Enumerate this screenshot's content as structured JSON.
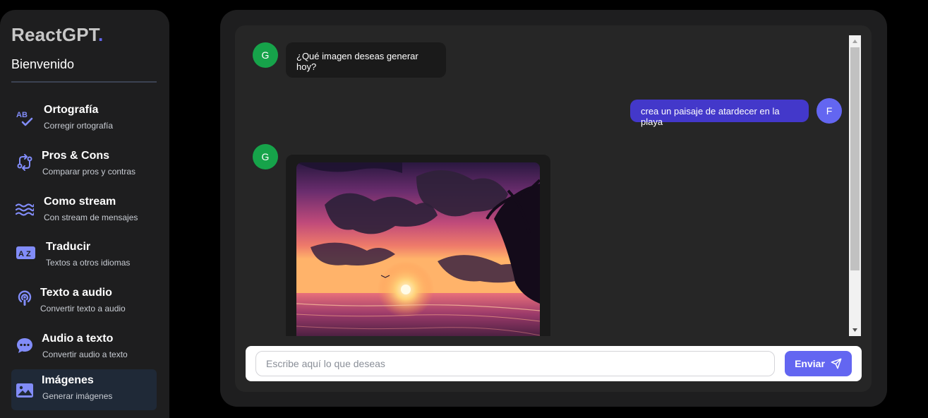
{
  "sidebar": {
    "brand": "ReactGPT",
    "brand_dot": ".",
    "welcome": "Bienvenido",
    "items": [
      {
        "title": "Ortografía",
        "subtitle": "Corregir ortografía",
        "icon": "spellcheck-icon"
      },
      {
        "title": "Pros & Cons",
        "subtitle": "Comparar pros y contras",
        "icon": "compare-arrows-icon"
      },
      {
        "title": "Como stream",
        "subtitle": "Con stream de mensajes",
        "icon": "waves-icon"
      },
      {
        "title": "Traducir",
        "subtitle": "Textos a otros idiomas",
        "icon": "translate-icon"
      },
      {
        "title": "Texto a audio",
        "subtitle": "Convertir texto a audio",
        "icon": "podcast-icon"
      },
      {
        "title": "Audio a texto",
        "subtitle": "Convertir audio a texto",
        "icon": "chat-bubble-icon"
      },
      {
        "title": "Imágenes",
        "subtitle": "Generar imágenes",
        "icon": "image-icon",
        "active": true
      }
    ]
  },
  "chat": {
    "messages": [
      {
        "from": "bot",
        "avatar": "G",
        "text": "¿Qué imagen deseas generar hoy?"
      },
      {
        "from": "user",
        "avatar": "F",
        "text": "crea un paisaje de atardecer en la playa"
      },
      {
        "from": "bot",
        "avatar": "G",
        "type": "image",
        "image": "sunset-beach-image"
      }
    ]
  },
  "input": {
    "placeholder": "Escribe aquí lo que deseas",
    "value": "",
    "send_label": "Enviar"
  },
  "colors": {
    "accent": "#6366f1",
    "user_bubble": "#4338ca",
    "bot_avatar": "#16a34a",
    "panel": "#1e1e1f",
    "chat_bg": "#262626"
  }
}
